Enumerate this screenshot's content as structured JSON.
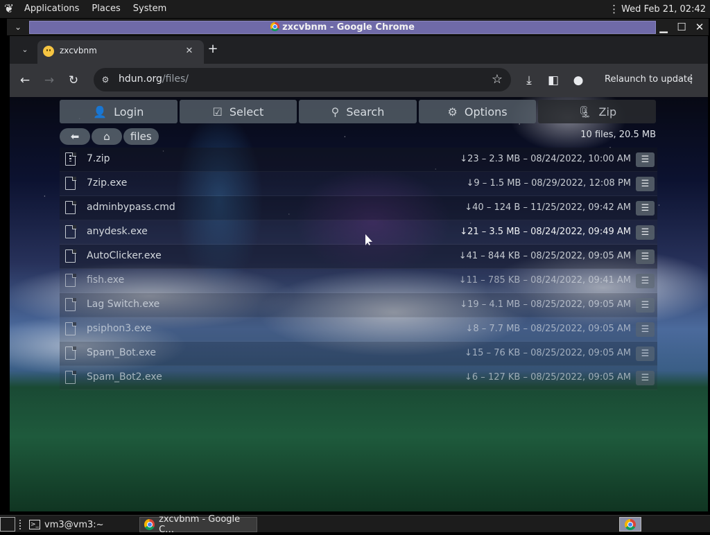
{
  "top_panel": {
    "applications": "Applications",
    "places": "Places",
    "system": "System",
    "clock": "Wed Feb 21, 02:42"
  },
  "wm": {
    "title": "zxcvbnm - Google Chrome",
    "minimize": "▁",
    "maximize": "☐",
    "close": "✕"
  },
  "tab": {
    "title": "zxcvbnm"
  },
  "toolbar": {
    "url_host": "hdun.org",
    "url_path": "/files/",
    "relaunch": "Relaunch to update"
  },
  "file_manager": {
    "buttons": {
      "login": "Login",
      "select": "Select",
      "search": "Search",
      "options": "Options",
      "zip": "Zip"
    },
    "breadcrumb_folder": "files",
    "summary": "10 files, 20.5 MB",
    "files": [
      {
        "name": "7.zip",
        "meta": "↓23 – 2.3 MB – 08/24/2022, 10:00 AM"
      },
      {
        "name": "7zip.exe",
        "meta": "↓9 – 1.5 MB – 08/29/2022, 12:08 PM"
      },
      {
        "name": "adminbypass.cmd",
        "meta": "↓40 – 124 B – 11/25/2022, 09:42 AM"
      },
      {
        "name": "anydesk.exe",
        "meta": "↓21 – 3.5 MB – 08/24/2022, 09:49 AM"
      },
      {
        "name": "AutoClicker.exe",
        "meta": "↓41 – 844 KB – 08/25/2022, 09:05 AM"
      },
      {
        "name": "fish.exe",
        "meta": "↓11 – 785 KB – 08/24/2022, 09:41 AM"
      },
      {
        "name": "Lag Switch.exe",
        "meta": "↓19 – 4.1 MB – 08/25/2022, 09:05 AM"
      },
      {
        "name": "psiphon3.exe",
        "meta": "↓8 – 7.7 MB – 08/25/2022, 09:05 AM"
      },
      {
        "name": "Spam_Bot.exe",
        "meta": "↓15 – 76 KB – 08/25/2022, 09:05 AM"
      },
      {
        "name": "Spam_Bot2.exe",
        "meta": "↓6 – 127 KB – 08/25/2022, 09:05 AM"
      }
    ]
  },
  "taskbar": {
    "terminal": "vm3@vm3:~",
    "chrome": "zxcvbnm - Google C…"
  }
}
